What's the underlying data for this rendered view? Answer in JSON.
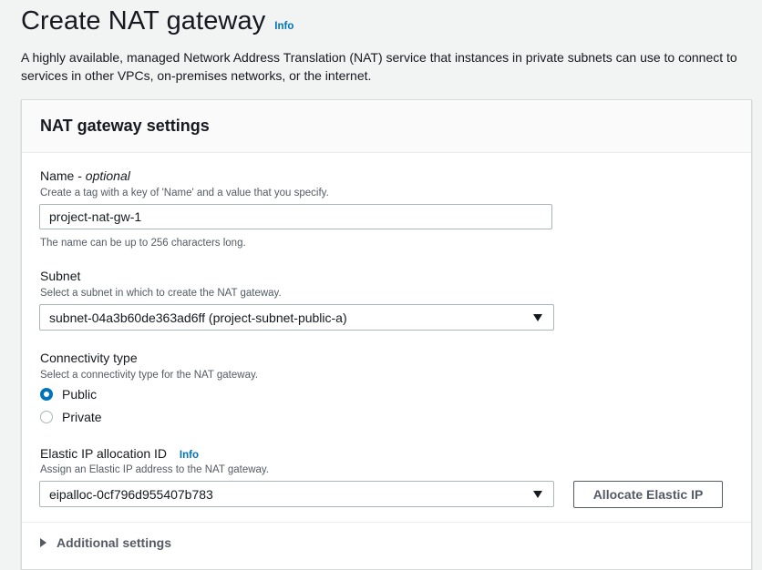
{
  "header": {
    "title": "Create NAT gateway",
    "info_label": "Info",
    "description": "A highly available, managed Network Address Translation (NAT) service that instances in private subnets can use to connect to services in other VPCs, on-premises networks, or the internet."
  },
  "panel": {
    "title": "NAT gateway settings"
  },
  "name_field": {
    "label": "Name - ",
    "label_optional": "optional",
    "description": "Create a tag with a key of 'Name' and a value that you specify.",
    "value": "project-nat-gw-1",
    "constraint": "The name can be up to 256 characters long."
  },
  "subnet_field": {
    "label": "Subnet",
    "description": "Select a subnet in which to create the NAT gateway.",
    "selected": "subnet-04a3b60de363ad6ff (project-subnet-public-a)"
  },
  "connectivity": {
    "label": "Connectivity type",
    "description": "Select a connectivity type for the NAT gateway.",
    "options": [
      {
        "label": "Public",
        "checked": true
      },
      {
        "label": "Private",
        "checked": false
      }
    ]
  },
  "elastic_ip": {
    "label": "Elastic IP allocation ID",
    "info_label": "Info",
    "description": "Assign an Elastic IP address to the NAT gateway.",
    "selected": "eipalloc-0cf796d955407b783",
    "allocate_button": "Allocate Elastic IP"
  },
  "additional_settings": {
    "label": "Additional settings"
  },
  "colors": {
    "link": "#0073bb",
    "text": "#16191f",
    "secondary_text": "#545b64",
    "border": "#aab7b8"
  }
}
